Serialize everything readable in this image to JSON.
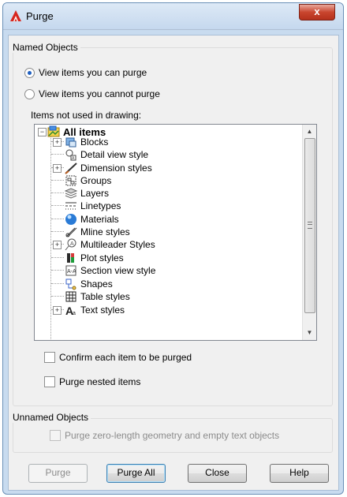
{
  "window": {
    "title": "Purge",
    "close_symbol": "x"
  },
  "named_objects": {
    "legend": "Named Objects",
    "radio_can_purge": "View items you can purge",
    "radio_cannot_purge": "View items you cannot purge",
    "selected_radio": "View items you can purge",
    "tree_label": "Items not used in drawing:"
  },
  "tree": {
    "root": "All items",
    "items": [
      {
        "label": "Blocks",
        "icon": "blocks-icon",
        "expandable": true
      },
      {
        "label": "Detail view style",
        "icon": "detail-view-icon",
        "expandable": false
      },
      {
        "label": "Dimension styles",
        "icon": "dimension-icon",
        "expandable": true
      },
      {
        "label": "Groups",
        "icon": "groups-icon",
        "expandable": false
      },
      {
        "label": "Layers",
        "icon": "layers-icon",
        "expandable": false
      },
      {
        "label": "Linetypes",
        "icon": "linetypes-icon",
        "expandable": false
      },
      {
        "label": "Materials",
        "icon": "materials-icon",
        "expandable": false
      },
      {
        "label": "Mline styles",
        "icon": "mline-icon",
        "expandable": false
      },
      {
        "label": "Multileader Styles",
        "icon": "multileader-icon",
        "expandable": true
      },
      {
        "label": "Plot styles",
        "icon": "plot-styles-icon",
        "expandable": false
      },
      {
        "label": "Section view style",
        "icon": "section-view-icon",
        "expandable": false
      },
      {
        "label": "Shapes",
        "icon": "shapes-icon",
        "expandable": false
      },
      {
        "label": "Table styles",
        "icon": "table-styles-icon",
        "expandable": false
      },
      {
        "label": "Text styles",
        "icon": "text-styles-icon",
        "expandable": true
      }
    ]
  },
  "options": {
    "confirm_each": "Confirm each item to be purged",
    "purge_nested": "Purge nested items"
  },
  "unnamed_objects": {
    "legend": "Unnamed Objects",
    "purge_zero_length": "Purge zero-length geometry and empty text objects"
  },
  "buttons": {
    "purge": "Purge",
    "purge_all": "Purge All",
    "close": "Close",
    "help": "Help"
  },
  "colors": {
    "title_bar": "#c8dbef",
    "close_button": "#c9452e",
    "radio_selected": "#1f5fbf"
  }
}
